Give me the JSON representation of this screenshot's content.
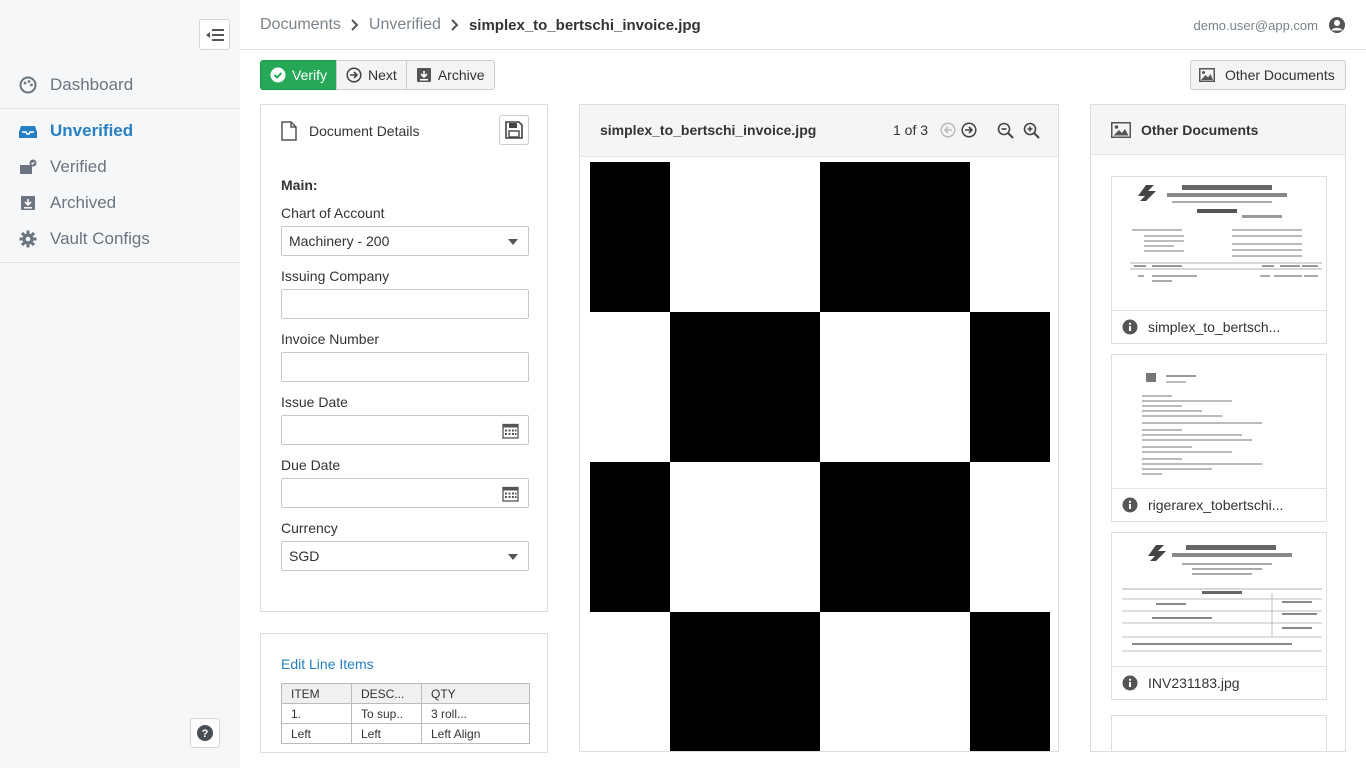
{
  "sidebar": {
    "items": [
      {
        "label": "Dashboard",
        "icon": "palette-icon",
        "active": false
      },
      {
        "label": "Unverified",
        "icon": "inbox-icon",
        "active": true
      },
      {
        "label": "Verified",
        "icon": "verified-inbox-icon",
        "active": false
      },
      {
        "label": "Archived",
        "icon": "archive-icon",
        "active": false
      },
      {
        "label": "Vault Configs",
        "icon": "gear-icon",
        "active": false
      }
    ]
  },
  "header": {
    "breadcrumb": [
      "Documents",
      "Unverified",
      "simplex_to_bertschi_invoice.jpg"
    ],
    "user_email": "demo.user@app.com"
  },
  "toolbar": {
    "verify_label": "Verify",
    "next_label": "Next",
    "archive_label": "Archive",
    "other_documents_label": "Other Documents"
  },
  "details": {
    "title": "Document Details",
    "section": "Main:",
    "fields": [
      {
        "label": "Chart of Account",
        "value": "Machinery - 200",
        "type": "select"
      },
      {
        "label": "Issuing Company",
        "value": "",
        "type": "text"
      },
      {
        "label": "Invoice Number",
        "value": "",
        "type": "text"
      },
      {
        "label": "Issue Date",
        "value": "",
        "type": "date"
      },
      {
        "label": "Due Date",
        "value": "",
        "type": "date"
      },
      {
        "label": "Currency",
        "value": "SGD",
        "type": "select"
      }
    ]
  },
  "line_items": {
    "edit_label": "Edit Line Items",
    "headers": [
      "ITEM",
      "DESC...",
      "QTY"
    ],
    "rows": [
      [
        "1.",
        "To sup..",
        "3 roll..."
      ],
      [
        "Left",
        "Left",
        "Left Align"
      ]
    ]
  },
  "viewer": {
    "title": "simplex_to_bertschi_invoice.jpg",
    "page_text": "1 of 3"
  },
  "others": {
    "title": "Other Documents",
    "docs": [
      {
        "name": "simplex_to_bertsch..."
      },
      {
        "name": "rigerarex_tobertschi..."
      },
      {
        "name": "INV231183.jpg"
      }
    ]
  },
  "colors": {
    "primary": "#26a957",
    "accent": "#2780c3"
  }
}
